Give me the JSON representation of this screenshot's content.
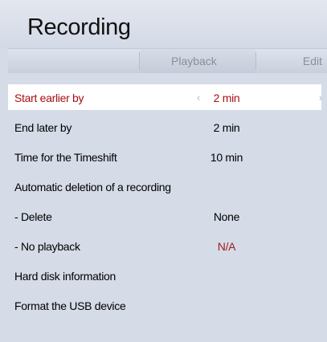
{
  "title": "Recording",
  "tabs": {
    "playback": "Playback",
    "edit": "Edit"
  },
  "rows": [
    {
      "label": "Start earlier by",
      "value": "2 min",
      "left_arrow": "‹",
      "right_arrow": "›"
    },
    {
      "label": "End later by",
      "value": "2 min"
    },
    {
      "label": "Time for the Timeshift",
      "value": "10 min"
    },
    {
      "label": "Automatic deletion of a recording",
      "value": ""
    },
    {
      "label": "- Delete",
      "value": "None"
    },
    {
      "label": "- No playback",
      "value": "N/A"
    },
    {
      "label": "Hard disk information",
      "value": ""
    },
    {
      "label": "Format the USB device",
      "value": ""
    }
  ],
  "colors": {
    "background": "#d5dbe7",
    "selected_text": "#a80e12",
    "na_value": "#9b1b1b"
  }
}
